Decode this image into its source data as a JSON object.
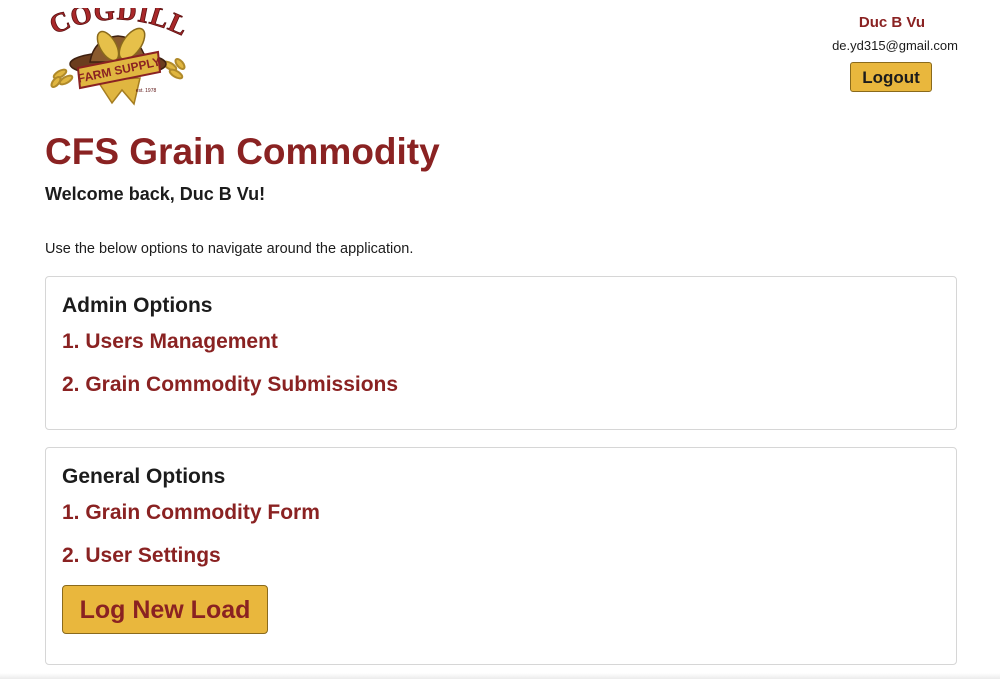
{
  "brand": {
    "logo_text": "COGDILL",
    "logo_subtext": "FARM SUPPLY",
    "logo_est": "est. 1978",
    "colors": {
      "primary": "#8a2222",
      "accent": "#e9b73d",
      "text": "#1c1c1c",
      "border": "#d6d6d6"
    }
  },
  "user": {
    "name": "Duc B Vu",
    "email": "de.yd315@gmail.com",
    "logout_label": "Logout"
  },
  "page": {
    "title": "CFS Grain Commodity",
    "welcome": "Welcome back, Duc B Vu!",
    "intro": "Use the below options to navigate around the application."
  },
  "admin_options": {
    "title": "Admin Options",
    "links": [
      {
        "label": "1. Users Management"
      },
      {
        "label": "2. Grain Commodity Submissions"
      }
    ]
  },
  "general_options": {
    "title": "General Options",
    "links": [
      {
        "label": "1. Grain Commodity Form"
      },
      {
        "label": "2. User Settings"
      }
    ],
    "log_button_label": "Log New Load"
  }
}
